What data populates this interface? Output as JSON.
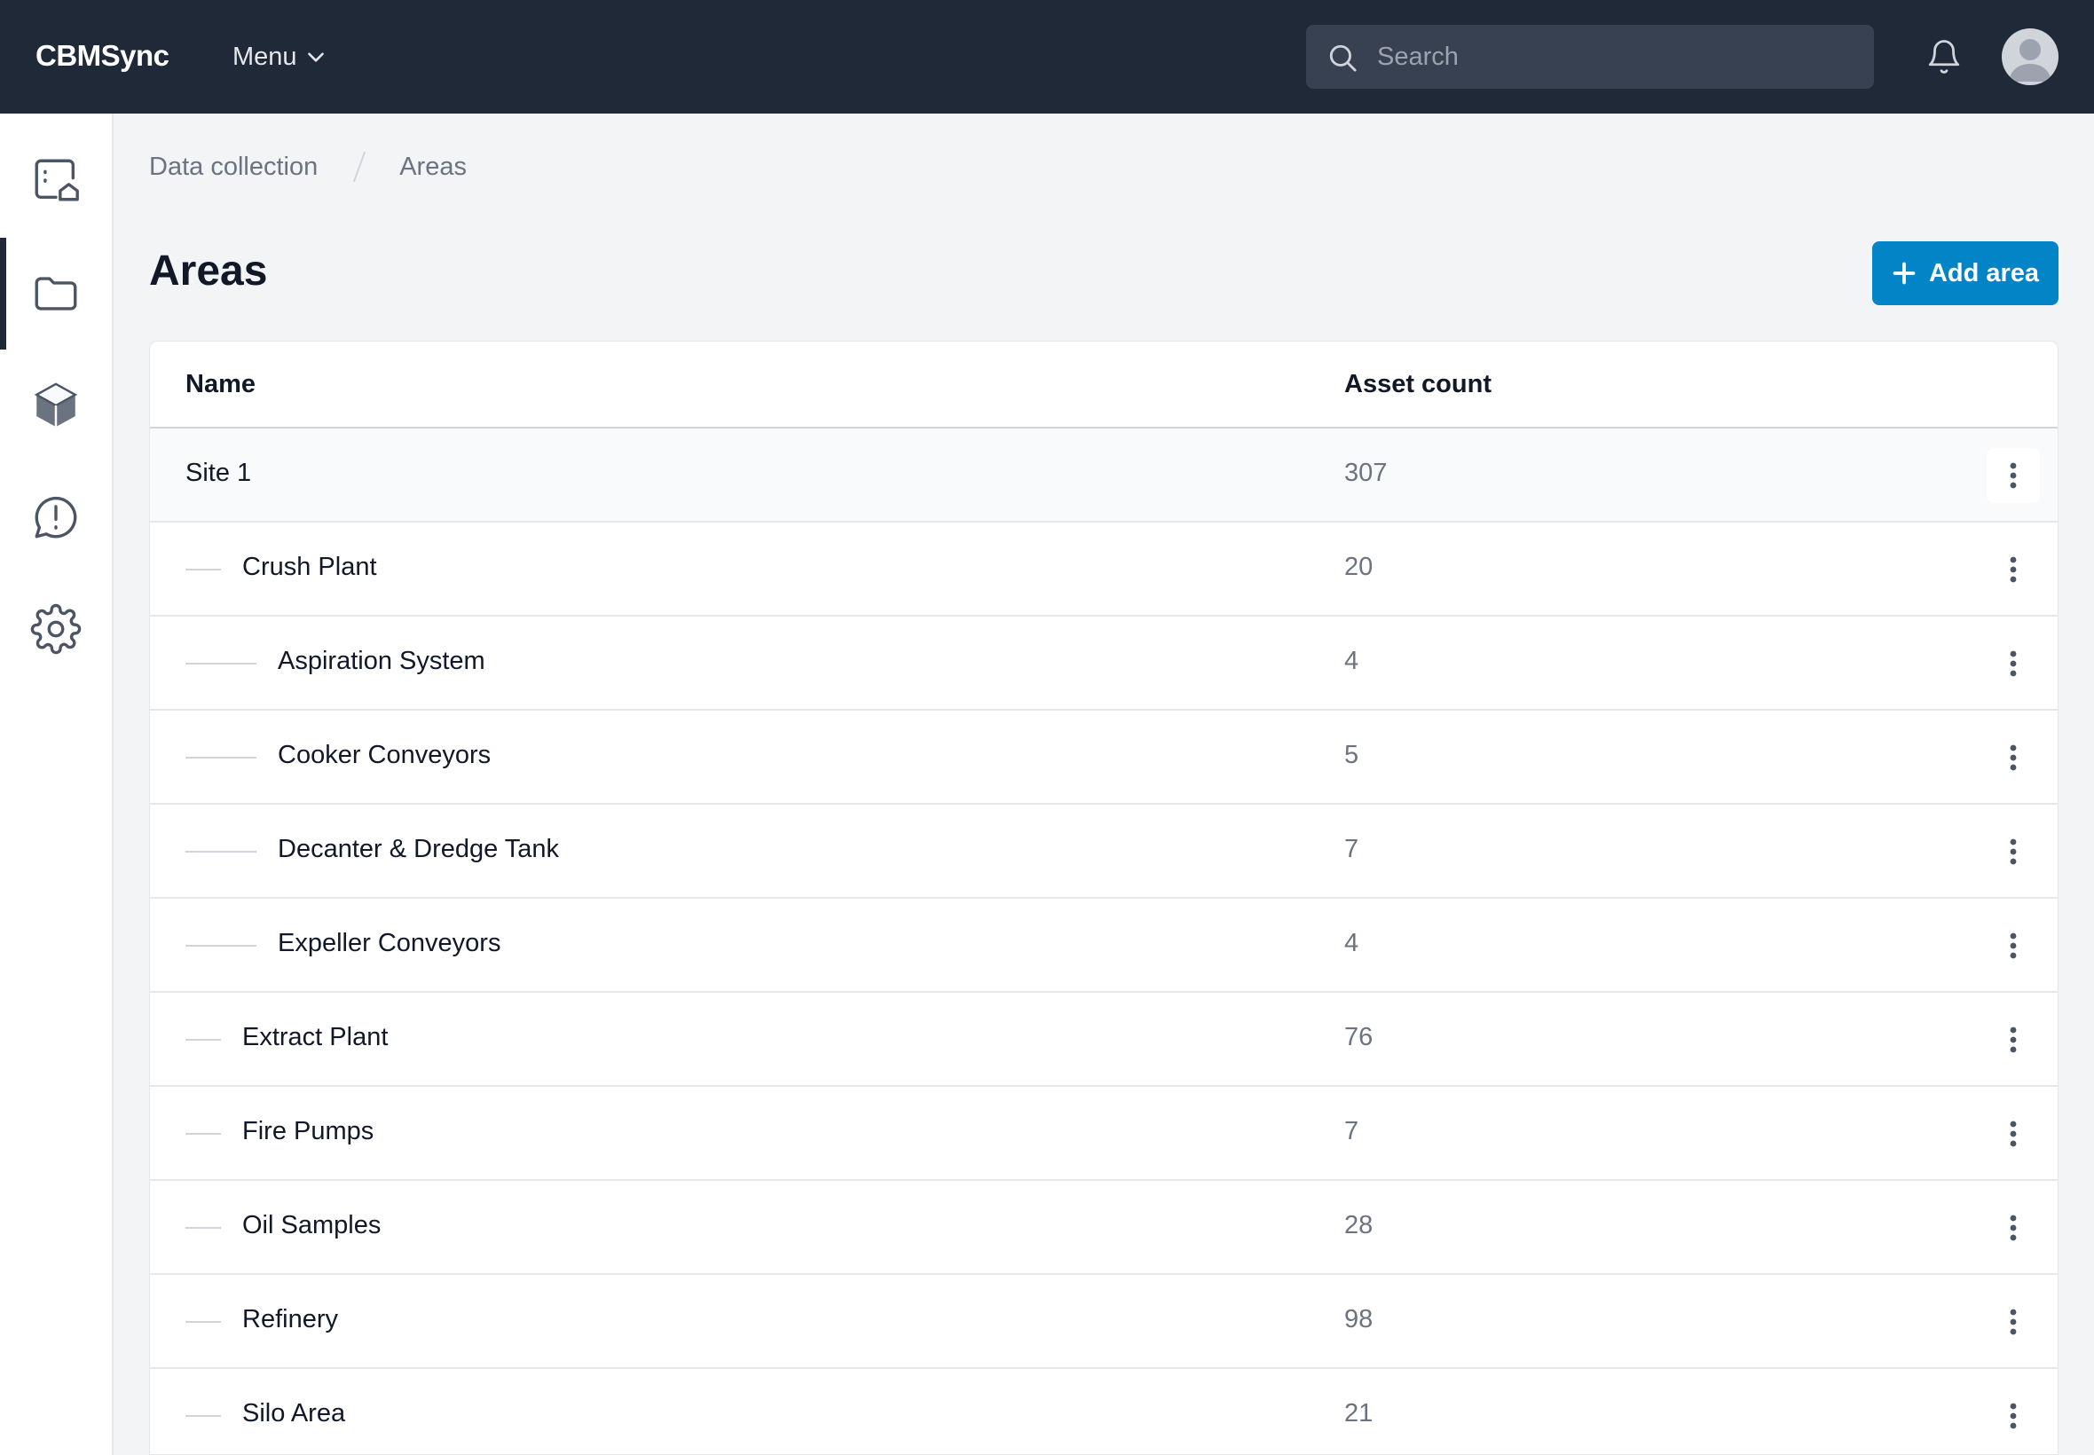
{
  "header": {
    "brand": "CBMSync",
    "menu_label": "Menu",
    "search_placeholder": "Search"
  },
  "sidebar": {
    "items": [
      {
        "name": "sidebar-item-dashboard",
        "icon": "dashboard-icon",
        "active": false
      },
      {
        "name": "sidebar-item-data-collection",
        "icon": "folder-icon",
        "active": true
      },
      {
        "name": "sidebar-item-assets",
        "icon": "cube-icon",
        "active": false
      },
      {
        "name": "sidebar-item-alerts",
        "icon": "alert-message-icon",
        "active": false
      },
      {
        "name": "sidebar-item-settings",
        "icon": "gear-icon",
        "active": false
      }
    ]
  },
  "breadcrumb": {
    "items": [
      "Data collection",
      "Areas"
    ]
  },
  "page": {
    "title": "Areas",
    "add_button_label": "Add area"
  },
  "table": {
    "columns": [
      "Name",
      "Asset count"
    ],
    "rows": [
      {
        "name": "Site 1",
        "count": "307",
        "level": 0
      },
      {
        "name": "Crush Plant",
        "count": "20",
        "level": 1
      },
      {
        "name": "Aspiration System",
        "count": "4",
        "level": 2
      },
      {
        "name": "Cooker Conveyors",
        "count": "5",
        "level": 2
      },
      {
        "name": "Decanter & Dredge Tank",
        "count": "7",
        "level": 2
      },
      {
        "name": "Expeller Conveyors",
        "count": "4",
        "level": 2
      },
      {
        "name": "Extract Plant",
        "count": "76",
        "level": 1
      },
      {
        "name": "Fire Pumps",
        "count": "7",
        "level": 1
      },
      {
        "name": "Oil Samples",
        "count": "28",
        "level": 1
      },
      {
        "name": "Refinery",
        "count": "98",
        "level": 1
      },
      {
        "name": "Silo Area",
        "count": "21",
        "level": 1
      }
    ]
  },
  "colors": {
    "topbar": "#1f2937",
    "accent": "#0284c7",
    "background": "#f3f4f6"
  }
}
